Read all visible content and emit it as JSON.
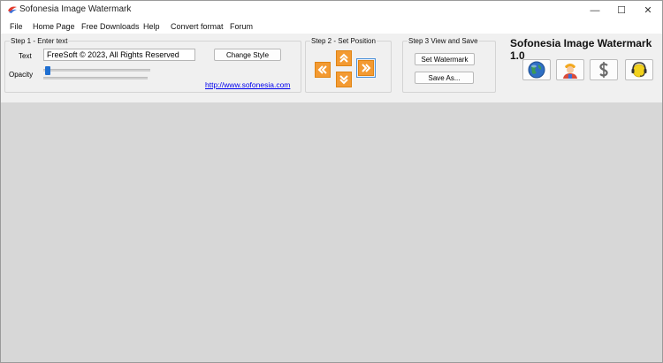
{
  "window": {
    "title": "Sofonesia Image Watermark",
    "minimize": "—",
    "maximize": "☐",
    "close": "✕"
  },
  "menu": [
    "File",
    "Home Page",
    "Free Downloads",
    "Help",
    "Convert format",
    "Forum"
  ],
  "step1": {
    "legend": "Step 1 - Enter text",
    "text_label": "Text",
    "text_value": "FreeSoft © 2023, All Rights Reserved",
    "opacity_label": "Opacity",
    "opacity_level": 0.02,
    "change_style": "Change Style",
    "website_link": "http://www.sofonesia.com"
  },
  "step2": {
    "legend": "Step 2 - Set Position",
    "selected_position": "right"
  },
  "step3": {
    "legend": "Step 3 View and Save",
    "set_watermark": "Set Watermark",
    "save_as": "Save As..."
  },
  "brand": "Sofonesia Image Watermark 1.0",
  "icons": [
    "globe-icon",
    "user-icon",
    "dollar-icon",
    "support-headset-icon"
  ],
  "colors": {
    "accent": "#f39a32",
    "link": "#0000ee",
    "thumb": "#1f6fd1",
    "workspace": "#d7d7d7"
  }
}
